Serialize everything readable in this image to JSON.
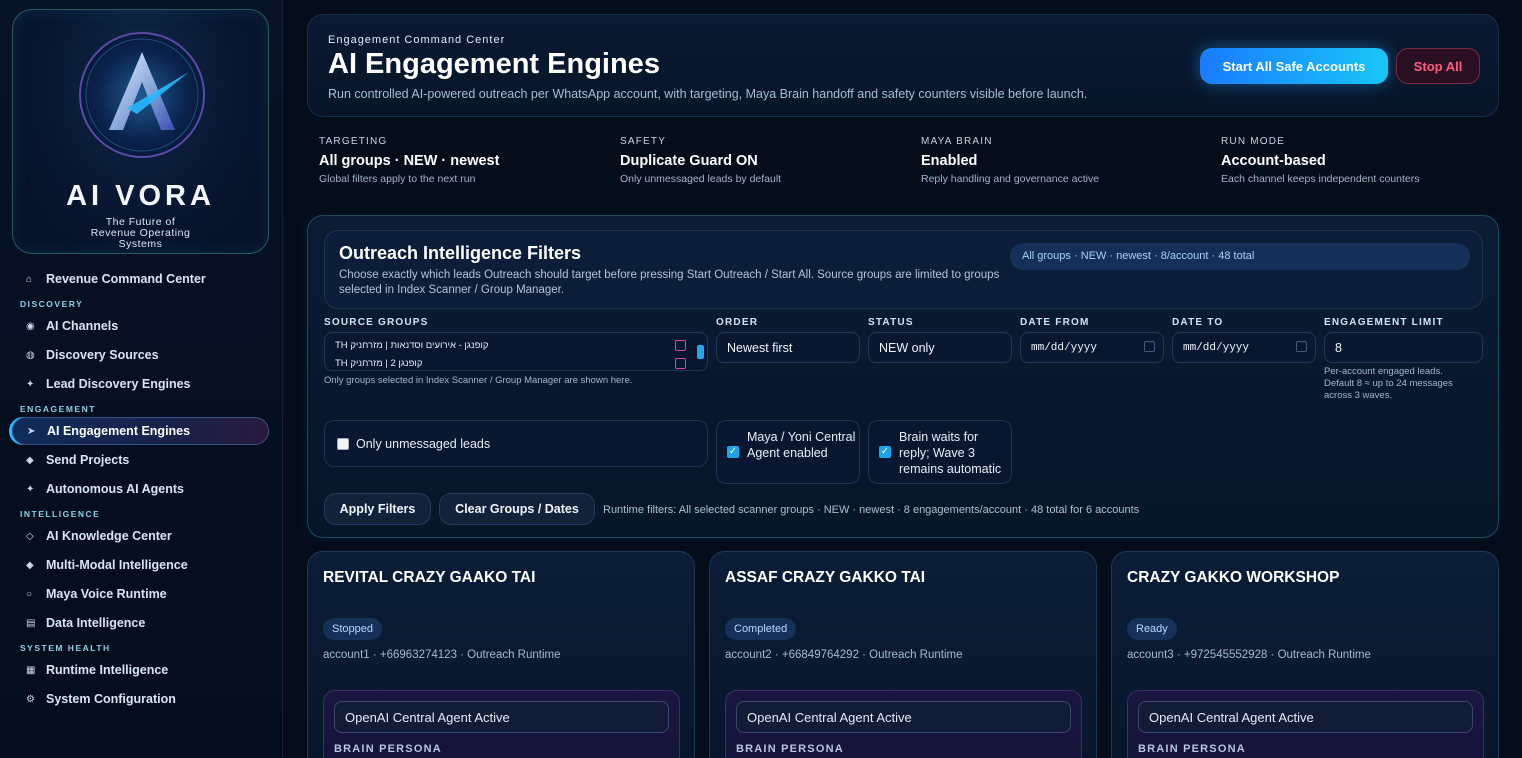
{
  "sidebar": {
    "brand": {
      "name": "AI VORA",
      "tagline": "The Future of Revenue Operating Systems"
    },
    "items": [
      {
        "label": "Revenue Command Center",
        "icon": "home-icon"
      },
      {
        "section": "DISCOVERY"
      },
      {
        "label": "AI Channels",
        "icon": "channels-icon"
      },
      {
        "label": "Discovery Sources",
        "icon": "sources-icon"
      },
      {
        "label": "Lead Discovery Engines",
        "icon": "spark-icon"
      },
      {
        "section": "ENGAGEMENT"
      },
      {
        "label": "AI Engagement Engines",
        "icon": "send-arrow-icon",
        "active": true
      },
      {
        "label": "Send Projects",
        "icon": "diamond-icon"
      },
      {
        "label": "Autonomous AI Agents",
        "icon": "star-icon"
      },
      {
        "section": "INTELLIGENCE"
      },
      {
        "label": "AI Knowledge Center",
        "icon": "diamond-outline-icon"
      },
      {
        "label": "Multi-Modal Intelligence",
        "icon": "diamond-icon"
      },
      {
        "label": "Maya Voice Runtime",
        "icon": "circle-icon"
      },
      {
        "label": "Data Intelligence",
        "icon": "database-icon"
      },
      {
        "section": "SYSTEM HEALTH"
      },
      {
        "label": "Runtime Intelligence",
        "icon": "grid-icon"
      },
      {
        "label": "System Configuration",
        "icon": "gear-icon"
      }
    ]
  },
  "header": {
    "eyebrow": "Engagement Command Center",
    "title": "AI Engagement Engines",
    "subtitle": "Run controlled AI-powered outreach per WhatsApp account, with targeting, Maya Brain handoff and safety counters visible before launch.",
    "start_button": "Start All Safe Accounts",
    "stop_button": "Stop All"
  },
  "stats": [
    {
      "label": "TARGETING",
      "value": "All groups · NEW · newest",
      "note": "Global filters apply to the next run"
    },
    {
      "label": "SAFETY",
      "value": "Duplicate Guard ON",
      "note": "Only unmessaged leads by default"
    },
    {
      "label": "MAYA BRAIN",
      "value": "Enabled",
      "note": "Reply handling and governance active"
    },
    {
      "label": "RUN MODE",
      "value": "Account-based",
      "note": "Each channel keeps independent counters"
    }
  ],
  "filters": {
    "title": "Outreach Intelligence Filters",
    "description": "Choose exactly which leads Outreach should target before pressing Start Outreach / Start All. Source groups are limited to groups selected in Index Scanner / Group Manager.",
    "summary_pill": "All groups · NEW · newest · 8/account · 48 total",
    "source_groups": {
      "label": "SOURCE GROUPS",
      "options": [
        "TH קופנגן - אירועים וסדנאות | מזרחניק",
        "TH קופנגן 2 | מזרחניק"
      ],
      "help": "Only groups selected in Index Scanner / Group Manager are shown here."
    },
    "order": {
      "label": "ORDER",
      "value": "Newest first"
    },
    "status": {
      "label": "STATUS",
      "value": "NEW only"
    },
    "date_from": {
      "label": "DATE FROM",
      "placeholder": "mm/dd/yyyy"
    },
    "date_to": {
      "label": "DATE TO",
      "placeholder": "mm/dd/yyyy"
    },
    "engagement_limit": {
      "label": "ENGAGEMENT LIMIT",
      "value": "8",
      "help": "Per-account engaged leads. Default 8 ≈ up to 24 messages across 3 waves."
    },
    "only_unmessaged": {
      "label": "Only unmessaged leads",
      "checked": false
    },
    "maya_yoni": {
      "label": "Maya / Yoni Central Agent enabled",
      "checked": true
    },
    "brain_waits": {
      "label": "Brain waits for reply; Wave 3 remains automatic",
      "checked": true
    },
    "apply_button": "Apply Filters",
    "clear_button": "Clear Groups / Dates",
    "runtime_text": "Runtime filters: All selected scanner groups · NEW · newest · 8 engagements/account · 48 total for 6 accounts"
  },
  "accounts": [
    {
      "name": "REVITAL CRAZY GAAKO TAI",
      "status": "Stopped",
      "meta": "account1 · +66963274123 · Outreach Runtime",
      "agent": "OpenAI Central Agent Active",
      "persona_label": "BRAIN PERSONA"
    },
    {
      "name": "ASSAF CRAZY GAKKO TAI",
      "status": "Completed",
      "meta": "account2 · +66849764292 · Outreach Runtime",
      "agent": "OpenAI Central Agent Active",
      "persona_label": "BRAIN PERSONA"
    },
    {
      "name": "CRAZY GAKKO WORKSHOP",
      "status": "Ready",
      "meta": "account3 · +972545552928 · Outreach Runtime",
      "agent": "OpenAI Central Agent Active",
      "persona_label": "BRAIN PERSONA"
    }
  ],
  "colors": {
    "accent": "#18c6f5",
    "danger": "#ff5d7e",
    "background": "#050c1a"
  }
}
